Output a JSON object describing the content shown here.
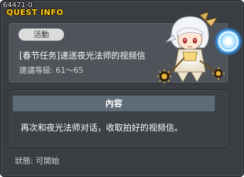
{
  "window": {
    "quest_id": "64471-0",
    "title": "QUEST INFO"
  },
  "summary": {
    "tag_label": "活動",
    "quest_name": "[春节任务]递送夜光法师的视频信",
    "level_label": "建議等級:",
    "level_range": "61～65"
  },
  "npc": {
    "icon": "luminous-mage-npc"
  },
  "content": {
    "header": "內容",
    "text": "再次和夜光法师对话，收取拍好的视频信。"
  },
  "status": {
    "label": "狀態:",
    "value": "可開始"
  },
  "colors": {
    "title": "#ffd21a",
    "window_bg": "#3a3d41",
    "panel_bg": "#4f535a",
    "header_bg": "#5e6c78"
  }
}
